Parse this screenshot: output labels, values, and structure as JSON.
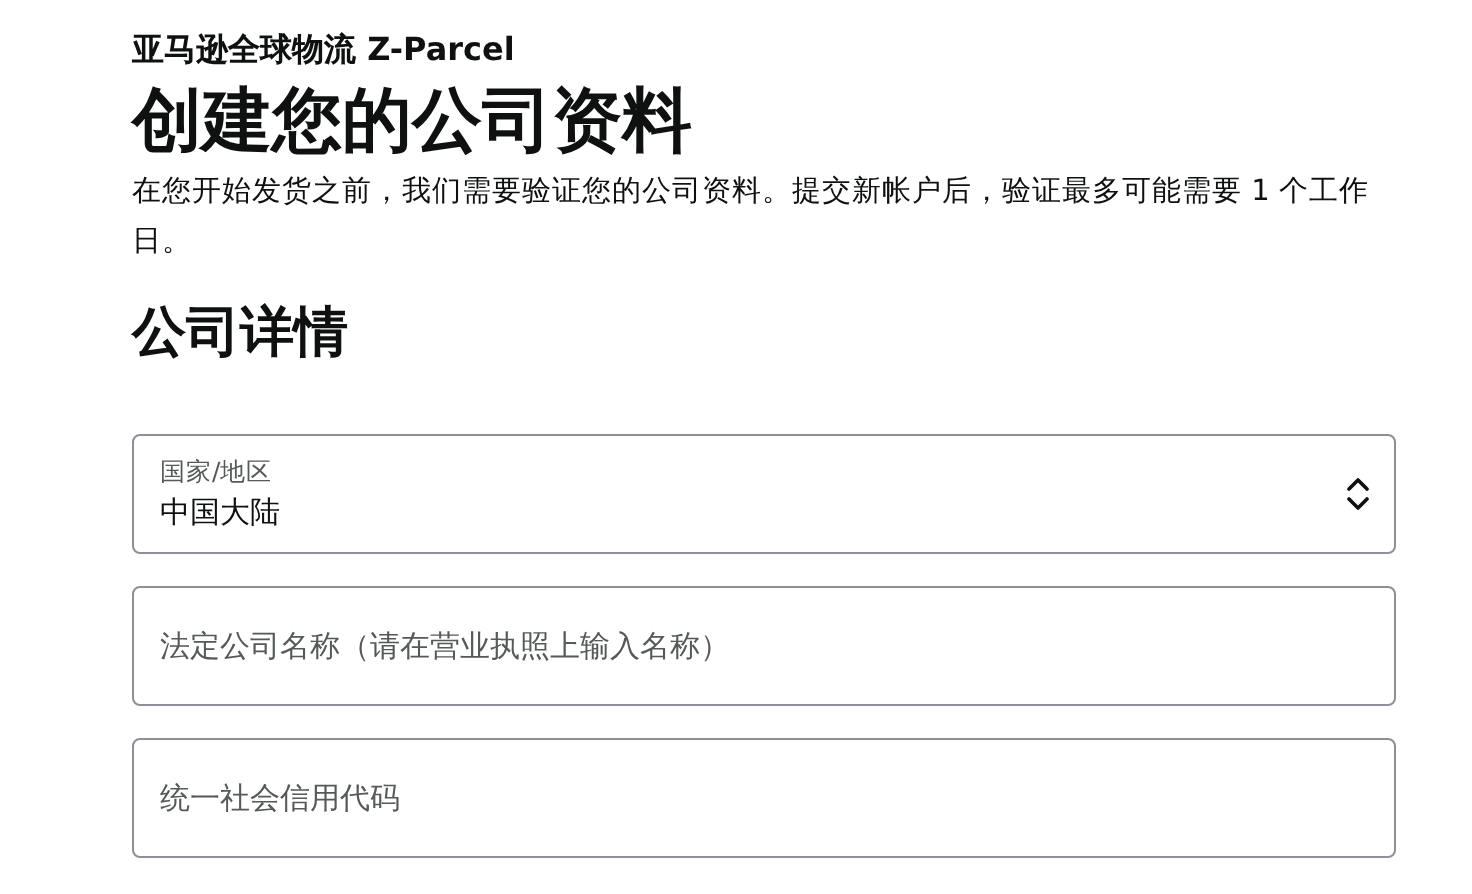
{
  "brand": "亚马逊全球物流 Z-Parcel",
  "title": "创建您的公司资料",
  "intro": "在您开始发货之前，我们需要验证您的公司资料。提交新帐户后，验证最多可能需要 1 个工作日。",
  "section": "公司详情",
  "fields": [
    {
      "kind": "select",
      "label": "国家/地区",
      "value": "中国大陆"
    },
    {
      "kind": "text",
      "placeholder": "法定公司名称（请在营业执照上输入名称）"
    },
    {
      "kind": "text",
      "placeholder": "统一社会信用代码"
    }
  ]
}
